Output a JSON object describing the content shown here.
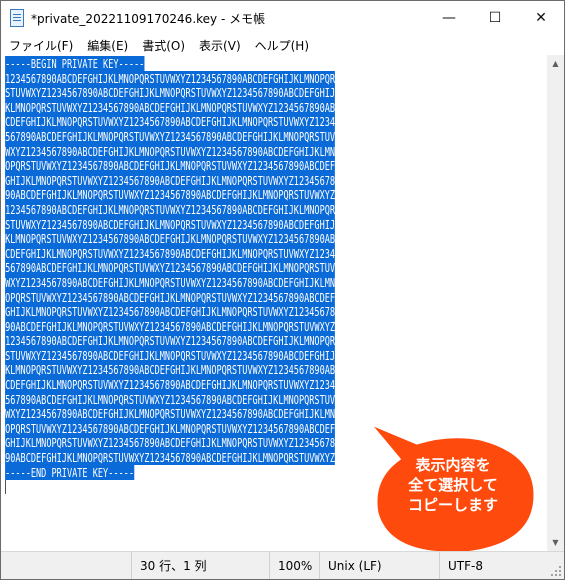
{
  "window": {
    "title": "*private_20221109170246.key - メモ帳",
    "minimize_glyph": "—",
    "maximize_glyph": "☐",
    "close_glyph": "✕"
  },
  "menu": [
    "ファイル(F)",
    "編集(E)",
    "書式(O)",
    "表示(V)",
    "ヘルプ(H)"
  ],
  "editor": {
    "lines": [
      "-----BEGIN PRIVATE KEY-----",
      "1234567890ABCDEFGHIJKLMNOPQRSTUVWXYZ1234567890ABCDEFGHIJKLMNOPQR",
      "STUVWXYZ1234567890ABCDEFGHIJKLMNOPQRSTUVWXYZ1234567890ABCDEFGHIJ",
      "KLMNOPQRSTUVWXYZ1234567890ABCDEFGHIJKLMNOPQRSTUVWXYZ1234567890AB",
      "CDEFGHIJKLMNOPQRSTUVWXYZ1234567890ABCDEFGHIJKLMNOPQRSTUVWXYZ1234",
      "567890ABCDEFGHIJKLMNOPQRSTUVWXYZ1234567890ABCDEFGHIJKLMNOPQRSTUV",
      "WXYZ1234567890ABCDEFGHIJKLMNOPQRSTUVWXYZ1234567890ABCDEFGHIJKLMN",
      "OPQRSTUVWXYZ1234567890ABCDEFGHIJKLMNOPQRSTUVWXYZ1234567890ABCDEF",
      "GHIJKLMNOPQRSTUVWXYZ1234567890ABCDEFGHIJKLMNOPQRSTUVWXYZ12345678",
      "90ABCDEFGHIJKLMNOPQRSTUVWXYZ1234567890ABCDEFGHIJKLMNOPQRSTUVWXYZ",
      "1234567890ABCDEFGHIJKLMNOPQRSTUVWXYZ1234567890ABCDEFGHIJKLMNOPQR",
      "STUVWXYZ1234567890ABCDEFGHIJKLMNOPQRSTUVWXYZ1234567890ABCDEFGHIJ",
      "KLMNOPQRSTUVWXYZ1234567890ABCDEFGHIJKLMNOPQRSTUVWXYZ1234567890AB",
      "CDEFGHIJKLMNOPQRSTUVWXYZ1234567890ABCDEFGHIJKLMNOPQRSTUVWXYZ1234",
      "567890ABCDEFGHIJKLMNOPQRSTUVWXYZ1234567890ABCDEFGHIJKLMNOPQRSTUV",
      "WXYZ1234567890ABCDEFGHIJKLMNOPQRSTUVWXYZ1234567890ABCDEFGHIJKLMN",
      "OPQRSTUVWXYZ1234567890ABCDEFGHIJKLMNOPQRSTUVWXYZ1234567890ABCDEF",
      "GHIJKLMNOPQRSTUVWXYZ1234567890ABCDEFGHIJKLMNOPQRSTUVWXYZ12345678",
      "90ABCDEFGHIJKLMNOPQRSTUVWXYZ1234567890ABCDEFGHIJKLMNOPQRSTUVWXYZ",
      "1234567890ABCDEFGHIJKLMNOPQRSTUVWXYZ1234567890ABCDEFGHIJKLMNOPQR",
      "STUVWXYZ1234567890ABCDEFGHIJKLMNOPQRSTUVWXYZ1234567890ABCDEFGHIJ",
      "KLMNOPQRSTUVWXYZ1234567890ABCDEFGHIJKLMNOPQRSTUVWXYZ1234567890AB",
      "CDEFGHIJKLMNOPQRSTUVWXYZ1234567890ABCDEFGHIJKLMNOPQRSTUVWXYZ1234",
      "567890ABCDEFGHIJKLMNOPQRSTUVWXYZ1234567890ABCDEFGHIJKLMNOPQRSTUV",
      "WXYZ1234567890ABCDEFGHIJKLMNOPQRSTUVWXYZ1234567890ABCDEFGHIJKLMN",
      "OPQRSTUVWXYZ1234567890ABCDEFGHIJKLMNOPQRSTUVWXYZ1234567890ABCDEF",
      "GHIJKLMNOPQRSTUVWXYZ1234567890ABCDEFGHIJKLMNOPQRSTUVWXYZ12345678",
      "90ABCDEFGHIJKLMNOPQRSTUVWXYZ1234567890ABCDEFGHIJKLMNOPQRSTUVWXYZ",
      "-----END PRIVATE KEY-----"
    ],
    "selection_color": "#0a6ad8"
  },
  "status": {
    "position": "30 行、1 列",
    "zoom": "100%",
    "line_ending": "Unix (LF)",
    "encoding": "UTF-8"
  },
  "callout": {
    "text_lines": [
      "表示内容を",
      "全て選択して",
      "コピーします"
    ],
    "fill_color": "#ff4a0d",
    "border_color": "#ffffff"
  }
}
